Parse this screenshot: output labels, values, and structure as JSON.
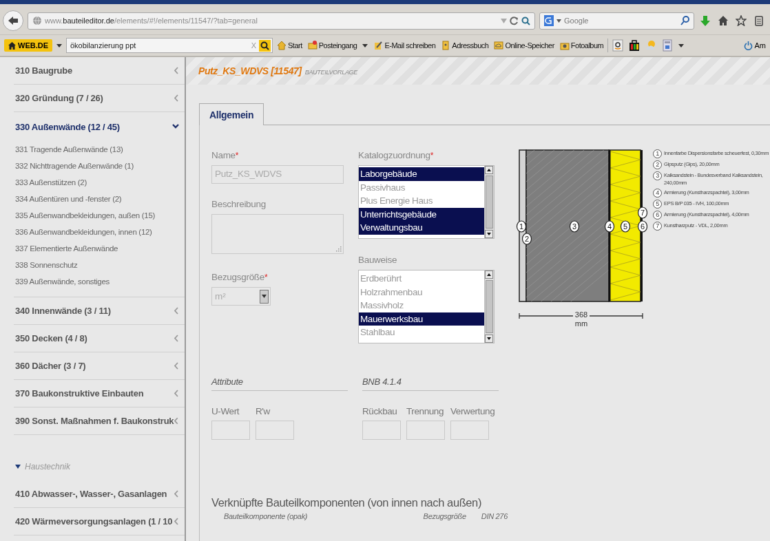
{
  "browser": {
    "url": "www.**bauteileditor.de**/elements/#!/elements/11547/?tab=general",
    "search_placeholder": "Google",
    "portal_label": "WEB.DE",
    "portal_search_value": "ökobilanzierung ppt",
    "portal_clear": "X",
    "bookmarks": [
      {
        "label": "Start",
        "kind": "home"
      },
      {
        "label": "Posteingang",
        "kind": "mail"
      },
      {
        "label": "E-Mail schreiben",
        "kind": "write"
      },
      {
        "label": "Adressbuch",
        "kind": "contacts"
      },
      {
        "label": "Online-Speicher",
        "kind": "cloud"
      },
      {
        "label": "Fotoalbum",
        "kind": "camera"
      }
    ],
    "logout_label": "Am"
  },
  "sidebar": {
    "items": [
      {
        "kind": "group",
        "label": "310 Baugrube",
        "expanded": false
      },
      {
        "kind": "group",
        "label": "320 Gründung (7 / 26)",
        "expanded": false
      },
      {
        "kind": "group",
        "label": "330 Außenwände (12 / 45)",
        "expanded": true,
        "children": [
          {
            "label": "331 Tragende Außenwände (13)"
          },
          {
            "label": "332 Nichttragende Außenwände (1)"
          },
          {
            "label": "333 Außenstützen (2)"
          },
          {
            "label": "334 Außentüren und -fenster (2)"
          },
          {
            "label": "335 Außenwandbekleidungen, außen (15)"
          },
          {
            "label": "336 Außenwandbekleidungen, innen (12)"
          },
          {
            "label": "337 Elementierte Außenwände"
          },
          {
            "label": "338 Sonnenschutz"
          },
          {
            "label": "339 Außenwände, sonstiges"
          }
        ]
      },
      {
        "kind": "group",
        "label": "340 Innenwände (3 / 11)",
        "expanded": false
      },
      {
        "kind": "group",
        "label": "350 Decken (4 / 8)",
        "expanded": false
      },
      {
        "kind": "group",
        "label": "360 Dächer (3 / 7)",
        "expanded": false
      },
      {
        "kind": "group",
        "label": "370 Baukonstruktive Einbauten",
        "expanded": false
      },
      {
        "kind": "group",
        "label": "390 Sonst. Maßnahmen f. Baukonstruk",
        "expanded": false
      },
      {
        "kind": "section",
        "label": "Haustechnik",
        "expanded": true
      },
      {
        "kind": "group",
        "label": "410 Abwasser-, Wasser-, Gasanlagen",
        "expanded": false
      },
      {
        "kind": "group",
        "label": "420 Wärmeversorgungsanlagen (1 / 10",
        "expanded": false
      }
    ]
  },
  "editor": {
    "title": "Putz_KS_WDVS [11547]",
    "subtitle": "BAUTEILVORLAGE",
    "tabs": [
      {
        "label": "Allgemein",
        "selected": true
      }
    ],
    "name": {
      "label": "Name",
      "required_mark": "*",
      "value": "Putz_KS_WDVS"
    },
    "description": {
      "label": "Beschreibung"
    },
    "reference_unit": {
      "label": "Bezugsgröße",
      "required_mark": "*",
      "value": "m²"
    },
    "catalog": {
      "label": "Katalogzuordnung",
      "required_mark": "*",
      "options": [
        {
          "label": "Laborgebäude",
          "selected": true
        },
        {
          "label": "Passivhaus",
          "selected": false
        },
        {
          "label": "Plus Energie Haus",
          "selected": false
        },
        {
          "label": "Unterrichtsgebäude",
          "selected": true
        },
        {
          "label": "Verwaltungsbau",
          "selected": true
        }
      ]
    },
    "construction": {
      "label": "Bauweise",
      "options": [
        {
          "label": "Erdberührt",
          "selected": false
        },
        {
          "label": "Holzrahmenbau",
          "selected": false
        },
        {
          "label": "Massivholz",
          "selected": false
        },
        {
          "label": "Mauerwerksbau",
          "selected": true
        },
        {
          "label": "Stahlbau",
          "selected": false
        }
      ]
    },
    "attributes": {
      "title": "Attribute",
      "fields": [
        {
          "label": "U-Wert"
        },
        {
          "label": "R'w"
        }
      ]
    },
    "bnb": {
      "title": "BNB 4.1.4",
      "fields": [
        {
          "label": "Rückbau"
        },
        {
          "label": "Trennung"
        },
        {
          "label": "Verwertung"
        }
      ]
    },
    "diagram": {
      "markers": [
        "1",
        "2",
        "3",
        "4",
        "5",
        "6",
        "7"
      ],
      "dimension": "368",
      "unit": "mm"
    },
    "legend": [
      {
        "number": "1",
        "text": "Innenfarbe Dispersionsfarbe scheuerfest, 0,30mm"
      },
      {
        "number": "2",
        "text": "Gipsputz (Gips), 20,00mm"
      },
      {
        "number": "3",
        "text": "Kalksandstein - Bundesverband Kalksandstein, 240,00mm"
      },
      {
        "number": "4",
        "text": "Armierung (Kunstharzspachtel), 3,00mm"
      },
      {
        "number": "5",
        "text": "EPS B/P 035 - IVH, 100,00mm"
      },
      {
        "number": "6",
        "text": "Armierung (Kunstharzspachtel), 4,00mm"
      },
      {
        "number": "7",
        "text": "Kunstharzputz - VDL, 2,00mm"
      }
    ],
    "components": {
      "title": "Verknüpfte Bauteilkomponenten (von innen nach außen)",
      "columns": [
        "Bauteilkomponente (opak)",
        "Bezugsgröße",
        "DIN 276"
      ]
    }
  }
}
